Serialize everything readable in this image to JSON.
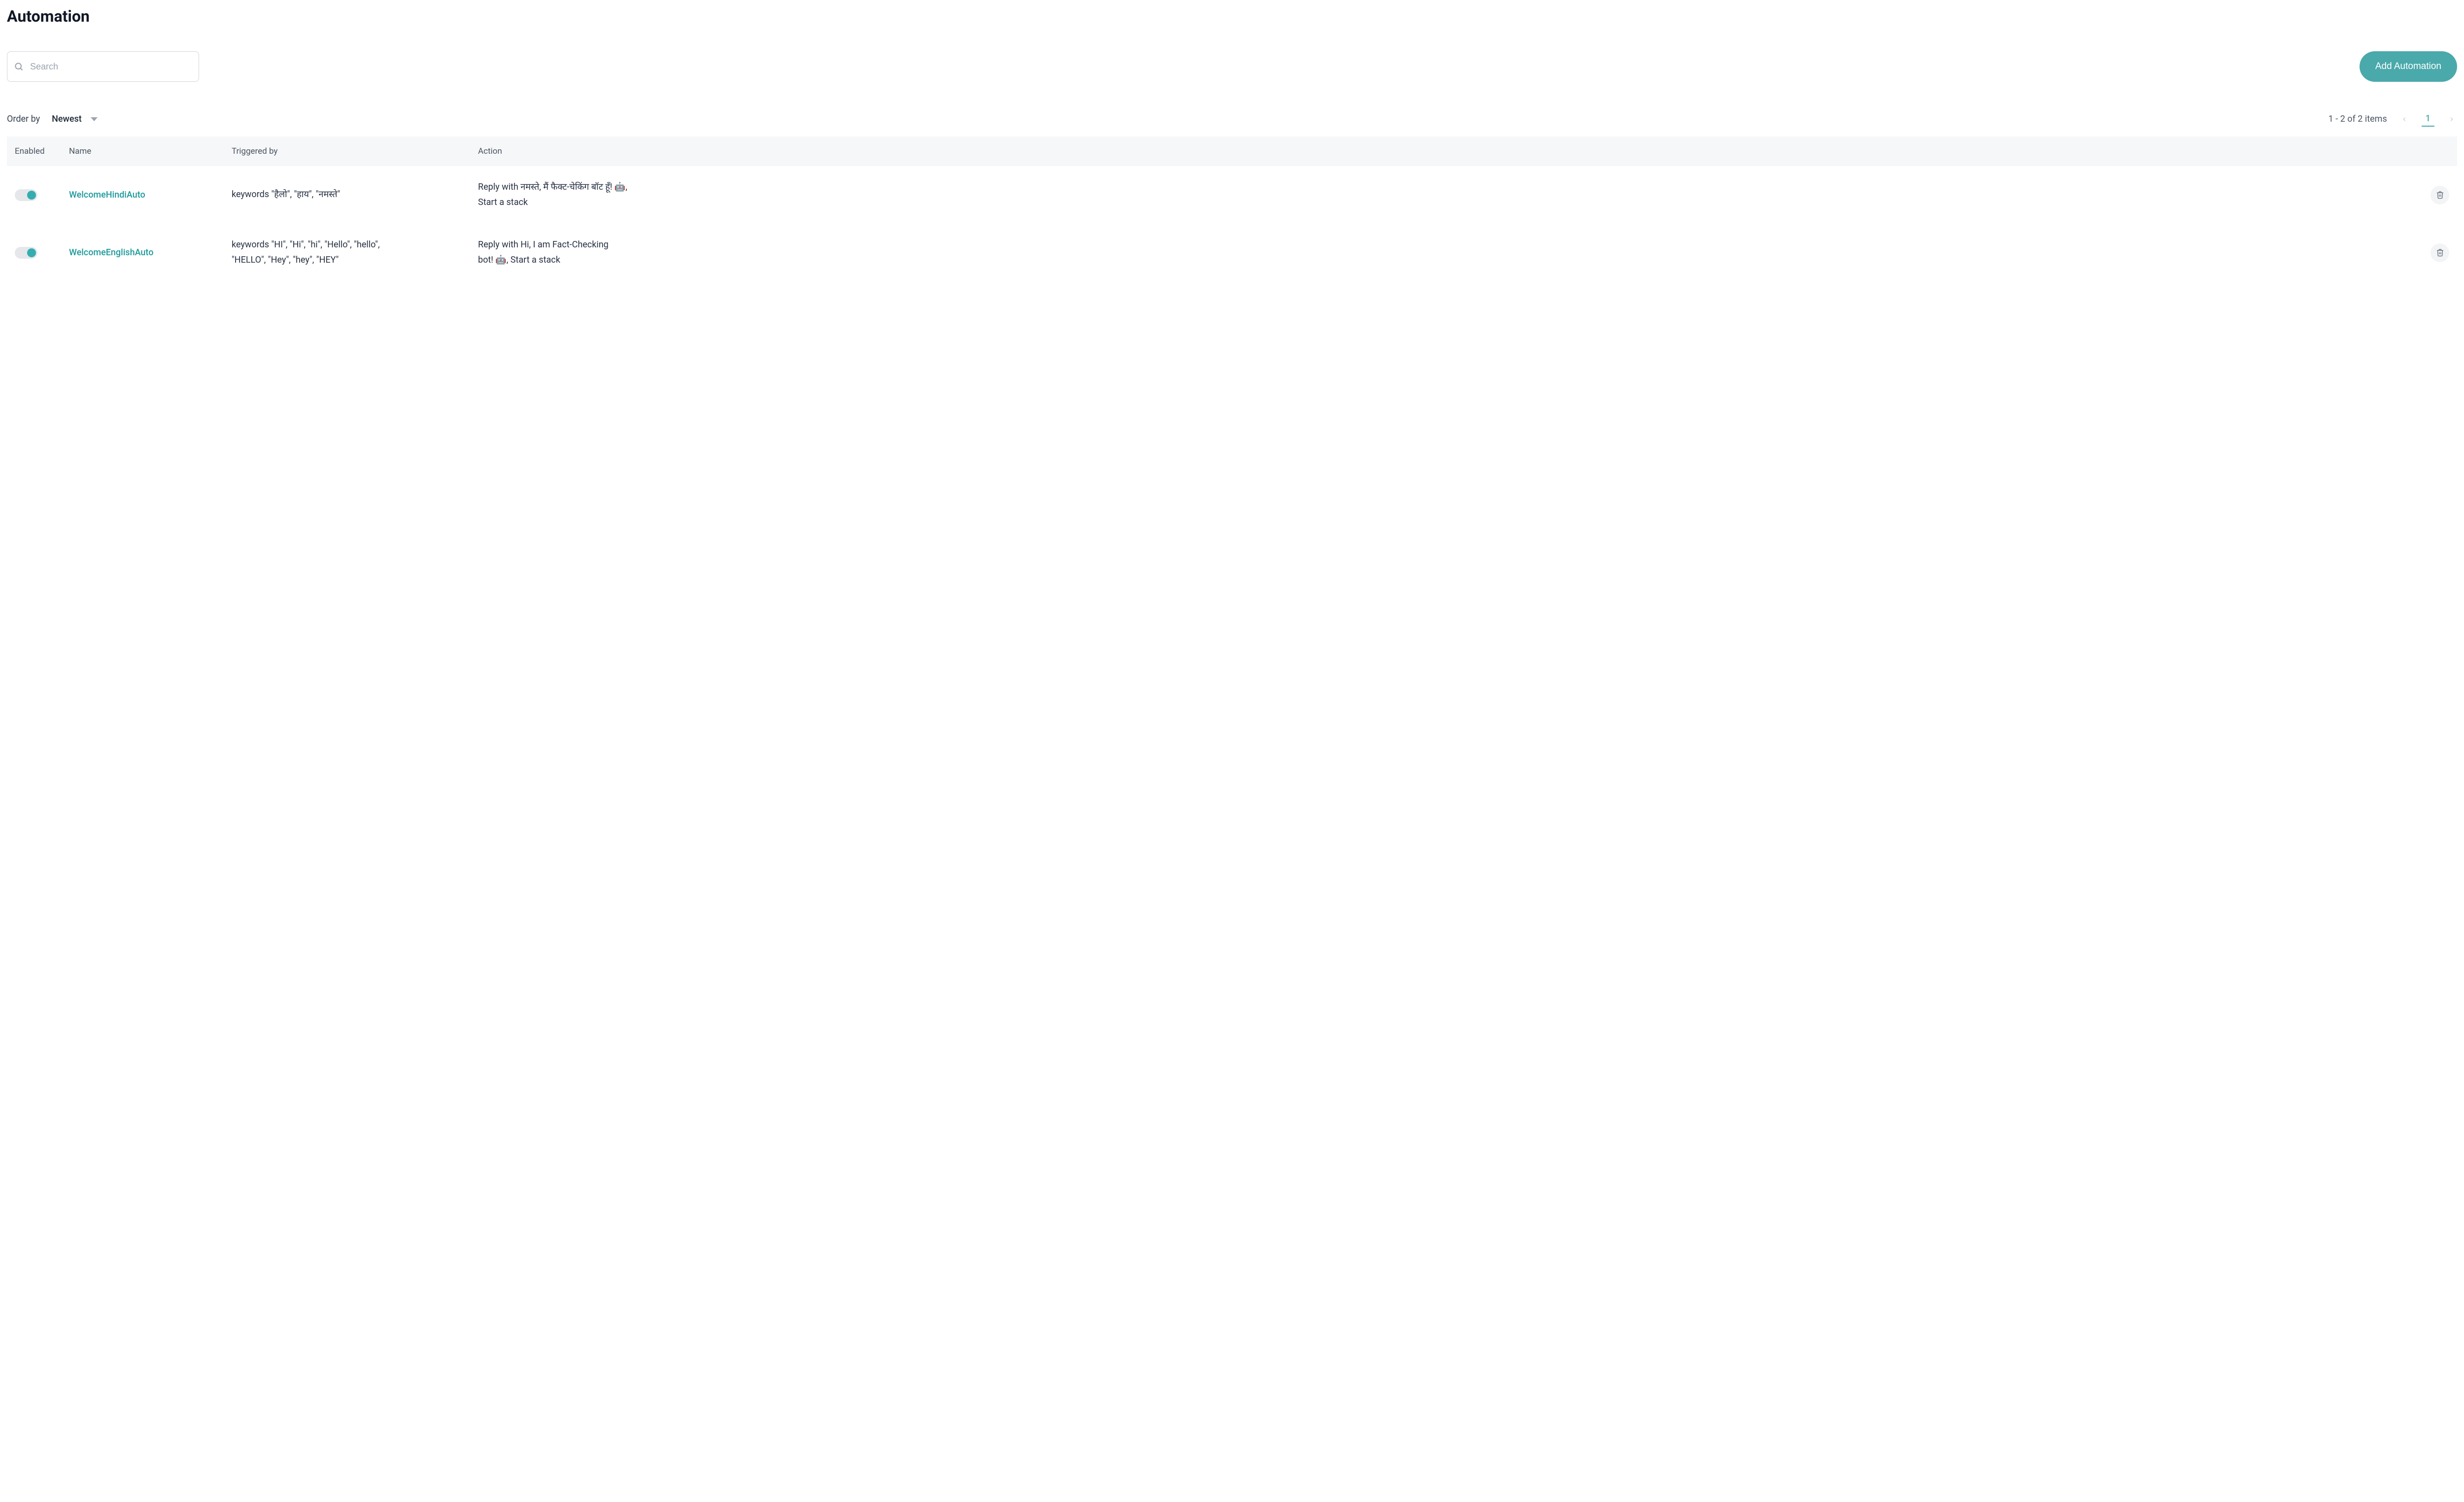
{
  "page": {
    "title": "Automation"
  },
  "search": {
    "placeholder": "Search"
  },
  "buttons": {
    "add_automation": "Add Automation"
  },
  "ordering": {
    "label": "Order by",
    "selected": "Newest"
  },
  "pagination": {
    "summary": "1 - 2 of 2 items",
    "current_page": "1"
  },
  "table": {
    "headers": {
      "enabled": "Enabled",
      "name": "Name",
      "trigger": "Triggered by",
      "action": "Action"
    },
    "rows": [
      {
        "enabled": true,
        "name": "WelcomeHindiAuto",
        "trigger": "keywords \"हैलो\", \"हाय\", \"नमस्ते\"",
        "action": "Reply with नमस्ते, मैं फैक्ट-चेकिंग बॉट हूँ! 🤖, Start a stack"
      },
      {
        "enabled": true,
        "name": "WelcomeEnglishAuto",
        "trigger": "keywords \"HI\", \"Hi\", \"hi\", \"Hello\", \"hello\", \"HELLO\", \"Hey\", \"hey\", \"HEY\"",
        "action": "Reply with Hi, I am Fact-Checking bot! 🤖, Start a stack"
      }
    ]
  }
}
